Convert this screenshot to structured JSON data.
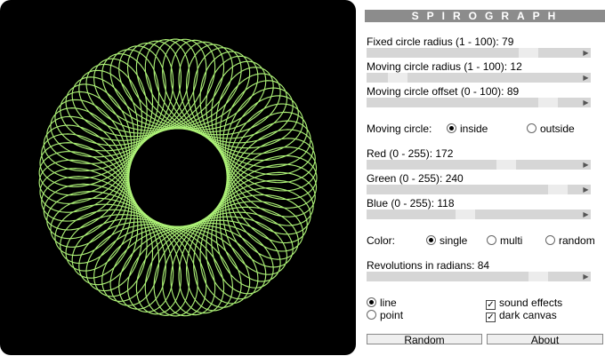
{
  "canvas": {
    "background": "#000000",
    "stroke_color": "#acf076",
    "fixed_radius": 79,
    "moving_radius": 12,
    "offset": 89,
    "moving": "inside",
    "revolutions": 84,
    "mode": "line"
  },
  "title": "SPIROGRAPH",
  "sliders": [
    {
      "label": "Fixed circle radius (1 - 100): 79",
      "value": 79,
      "min": 1,
      "max": 100
    },
    {
      "label": "Moving circle radius (1 - 100): 12",
      "value": 12,
      "min": 1,
      "max": 100
    },
    {
      "label": "Moving circle offset (0 - 100): 89",
      "value": 89,
      "min": 0,
      "max": 100
    },
    {
      "label": "Red (0 - 255): 172",
      "value": 172,
      "min": 0,
      "max": 255
    },
    {
      "label": "Green (0 - 255): 240",
      "value": 240,
      "min": 0,
      "max": 255
    },
    {
      "label": "Blue (0 - 255): 118",
      "value": 118,
      "min": 0,
      "max": 255
    },
    {
      "label": "Revolutions in radians: 84",
      "value": 84,
      "min": 0,
      "max": 100
    }
  ],
  "moving_circle": {
    "label": "Moving circle:",
    "options": [
      "inside",
      "outside"
    ],
    "selected": "inside"
  },
  "color_mode": {
    "label": "Color:",
    "options": [
      "single",
      "multi",
      "random"
    ],
    "selected": "single"
  },
  "draw_mode": {
    "options": [
      "line",
      "point"
    ],
    "selected": "line"
  },
  "checkboxes": [
    {
      "label": "sound effects",
      "checked": true
    },
    {
      "label": "dark canvas",
      "checked": true
    }
  ],
  "buttons": {
    "random": "Random",
    "about": "About"
  }
}
